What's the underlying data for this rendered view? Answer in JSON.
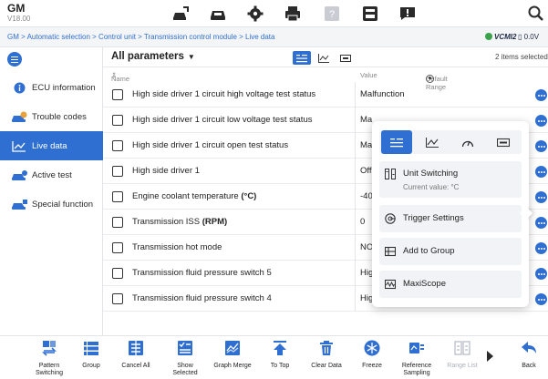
{
  "header": {
    "model": "GM",
    "version": "V18.00"
  },
  "toolbar_icons": [
    "vehicle-home-icon",
    "vehicle-diagnose-icon",
    "settings-gear-icon",
    "print-icon",
    "help-icon",
    "save-icon",
    "message-icon",
    "search-icon"
  ],
  "breadcrumb": "GM > Automatic selection > Control unit > Transmission control module > Live data",
  "status": {
    "vci_label": "VCMI2",
    "battery_label": "0.0V"
  },
  "sidebar": {
    "items": [
      {
        "label": "ECU information",
        "icon": "info-icon"
      },
      {
        "label": "Trouble codes",
        "icon": "car-dtc-icon"
      },
      {
        "label": "Live data",
        "icon": "line-chart-icon"
      },
      {
        "label": "Active test",
        "icon": "car-active-icon"
      },
      {
        "label": "Special function",
        "icon": "car-special-icon"
      }
    ],
    "active_index": 2
  },
  "panel": {
    "title": "All parameters",
    "selected_count": "2 items selected",
    "columns": {
      "name": "Name",
      "value": "Value",
      "range": "Default Range"
    }
  },
  "rows": [
    {
      "name": "High side driver 1 circuit high voltage test status",
      "unit": "",
      "value": "Malfunction"
    },
    {
      "name": "High side driver 1 circuit low voltage test status",
      "unit": "",
      "value": "Ma"
    },
    {
      "name": "High side driver 1 circuit open test status",
      "unit": "",
      "value": "Ma"
    },
    {
      "name": "High side driver 1",
      "unit": "",
      "value": "Off"
    },
    {
      "name": "Engine coolant temperature ",
      "unit": "(°C)",
      "value": "-40"
    },
    {
      "name": "Transmission ISS ",
      "unit": "(RPM)",
      "value": "0"
    },
    {
      "name": "Transmission hot mode",
      "unit": "",
      "value": "NO"
    },
    {
      "name": "Transmission fluid pressure switch 5",
      "unit": "",
      "value": "Hig"
    },
    {
      "name": "Transmission fluid pressure switch 4",
      "unit": "",
      "value": "High"
    }
  ],
  "popup": {
    "tabs": [
      "text-view-icon",
      "waveform-icon",
      "gauge-icon",
      "digital-icon"
    ],
    "unit_switching": {
      "label": "Unit Switching",
      "current": "Current value: °C"
    },
    "items": [
      "Trigger Settings",
      "Add to Group",
      "MaxiScope"
    ]
  },
  "bottom": [
    {
      "label": "Pattern\nSwitching",
      "icon": "pattern-switch-icon",
      "enabled": true
    },
    {
      "label": "Group",
      "icon": "group-icon",
      "enabled": true
    },
    {
      "label": "Cancel All",
      "icon": "cancel-all-icon",
      "enabled": true
    },
    {
      "label": "Show\nSelected",
      "icon": "show-selected-icon",
      "enabled": true
    },
    {
      "label": "Graph Merge",
      "icon": "graph-merge-icon",
      "enabled": true
    },
    {
      "label": "To Top",
      "icon": "to-top-icon",
      "enabled": true
    },
    {
      "label": "Clear Data",
      "icon": "trash-icon",
      "enabled": true
    },
    {
      "label": "Freeze",
      "icon": "freeze-icon",
      "enabled": true
    },
    {
      "label": "Reference\nSampling",
      "icon": "reference-sampling-icon",
      "enabled": true
    },
    {
      "label": "Range List",
      "icon": "range-list-icon",
      "enabled": false
    },
    {
      "label": "Back",
      "icon": "back-arrow-icon",
      "enabled": true
    }
  ],
  "colors": {
    "accent": "#2f6fd2",
    "text": "#222222",
    "disabled": "#aab0ba"
  }
}
